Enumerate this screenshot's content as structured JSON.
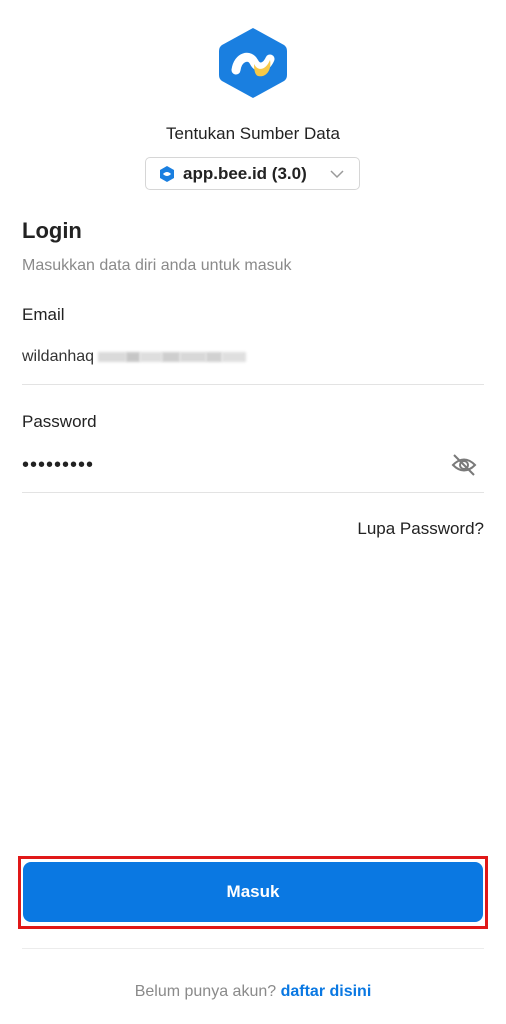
{
  "header": {
    "logo_icon": "bee-hexagon-logo-icon",
    "source_title": "Tentukan Sumber Data",
    "source_select": {
      "icon": "bee-source-icon",
      "value": "app.bee.id (3.0)",
      "chevron_icon": "chevron-down-icon"
    }
  },
  "login": {
    "title": "Login",
    "subtitle": "Masukkan data diri anda untuk masuk"
  },
  "email": {
    "label": "Email",
    "value_visible": "wildanhaq",
    "value_obscured": true
  },
  "password": {
    "label": "Password",
    "value_masked": "•••••••••",
    "toggle_icon": "eye-off-icon"
  },
  "forgot_label": "Lupa Password?",
  "submit_label": "Masuk",
  "register": {
    "prompt": "Belum punya akun?",
    "link": "daftar disini"
  },
  "colors": {
    "accent": "#0a78e2",
    "logo_blue": "#1a7fe0",
    "logo_yellow": "#f7c948",
    "highlight": "#e01818"
  }
}
